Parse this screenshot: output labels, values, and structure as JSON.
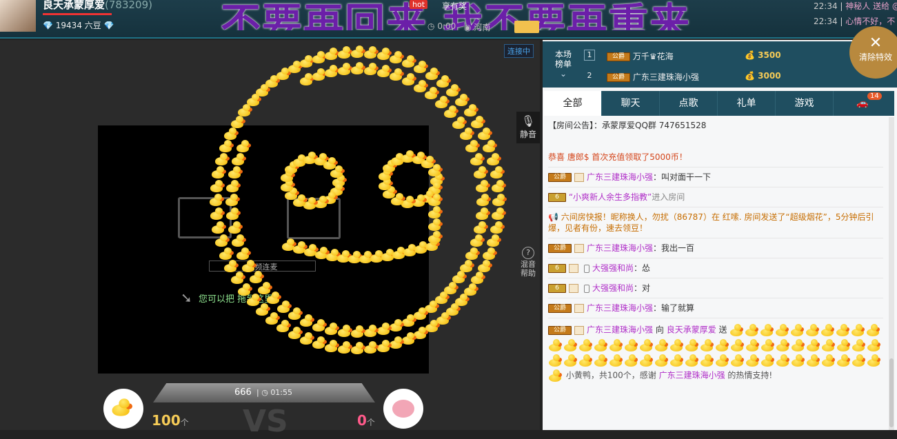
{
  "header": {
    "anchor_name": "良天承蒙厚爱",
    "anchor_id": "(783209)",
    "beans_text": "19434 六豆",
    "banner_text": "不要再回来 我不要再重来",
    "hot_label": "hot",
    "share_label": "享有奖",
    "time_text": "0:00",
    "location": "河南"
  },
  "ticker": [
    {
      "time": "22:34",
      "text": "神秘人 送给 @"
    },
    {
      "time": "22:34",
      "text": "心情不好，不"
    }
  ],
  "stage": {
    "connecting_label": "连接中",
    "mute_label": "静音",
    "help_label": "混音帮助",
    "video_connect_label": "视频连麦",
    "drag_hint": "您可以把 拖到这里"
  },
  "pk": {
    "score": "666",
    "timer": "01:55",
    "left_count": "100",
    "right_count": "0",
    "unit": "个",
    "vs": "VS"
  },
  "rank": {
    "title": "本场榜单",
    "rows": [
      {
        "num": "1",
        "badge": "公爵",
        "name": "万千♛花海",
        "value": "3500"
      },
      {
        "num": "2",
        "badge": "公爵",
        "name": "广东三建珠海小强",
        "value": "3000"
      }
    ]
  },
  "clear_effects_label": "清除特效",
  "tabs": [
    {
      "label": "全部"
    },
    {
      "label": "聊天"
    },
    {
      "label": "点歌"
    },
    {
      "label": "礼单"
    },
    {
      "label": "游戏"
    }
  ],
  "car_count": "14",
  "chat": {
    "notice": "【房间公告】：承蒙厚爱QQ群 747651528",
    "congrats": "恭喜 唐郎$ 首次充值领取了5000币！",
    "m1_user": "广东三建珠海小强",
    "m1_text": "：叫对面干一下",
    "m2_user": "“小爽新人余生多指教”",
    "m2_text": "进入房间",
    "broadcast": "六间房快报！昵称换人，勿扰（86787）在 红嗦. 房间发送了“超级烟花”，5分钟后引爆，见者有份，速去领豆！",
    "m3_user": "广东三建珠海小强",
    "m3_text": "：我出一百",
    "m4_user": "大强强和尚",
    "m4_text": "：怂",
    "m5_user": "大强强和尚",
    "m5_text": "：对",
    "m6_user": "广东三建珠海小强",
    "m6_text": "：输了就算",
    "gift_from": "广东三建珠海小强",
    "gift_to_word": "向",
    "gift_to": "良天承蒙厚爱",
    "gift_send_word": "送",
    "gift_summary_a": "小黄鸭，共100个，感谢",
    "gift_summary_user": "广东三建珠海小强",
    "gift_summary_b": "的热情支持!"
  },
  "colors": {
    "accent": "#1f4e60",
    "gold": "#f5cb57",
    "duck": "#f5b700"
  }
}
